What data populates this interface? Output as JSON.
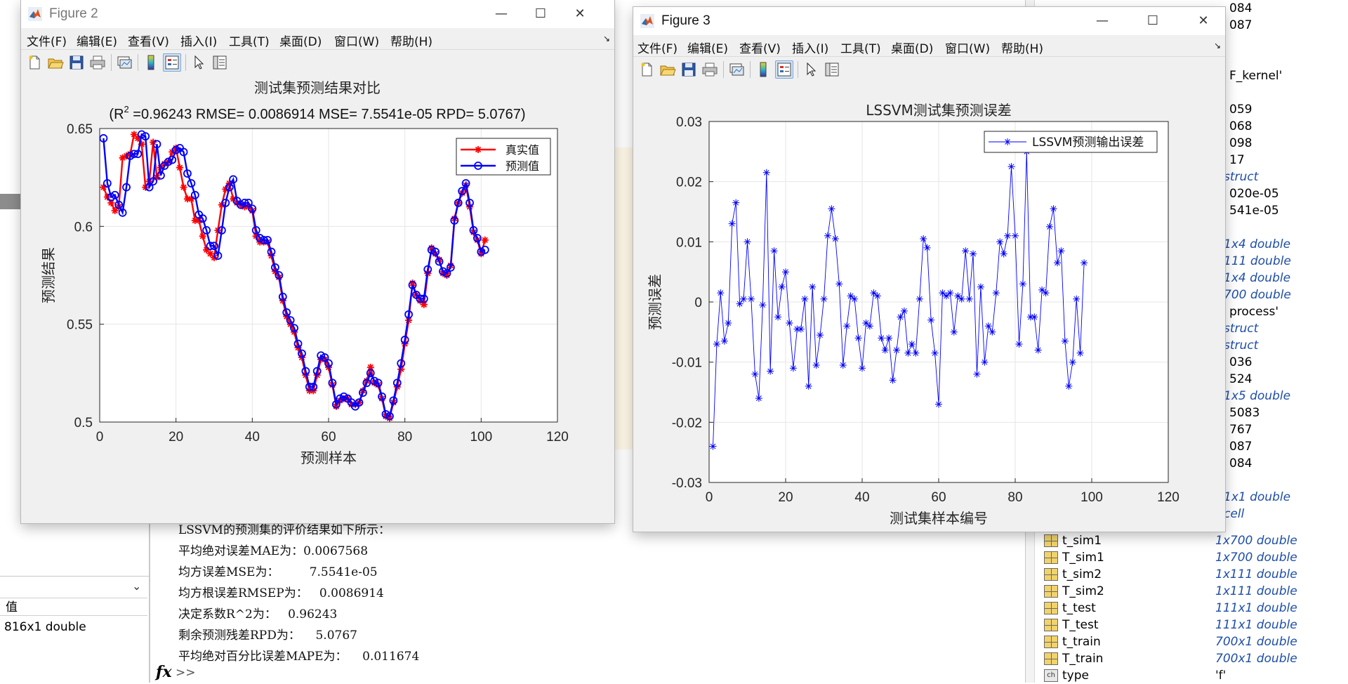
{
  "desktop": {
    "left_panel": {
      "header": "值",
      "value": "816x1 double"
    },
    "command_window": {
      "lines": [
        "LSSVM的预测集的评价结果如下所示：",
        "平均绝对误差MAE为：0.0067568",
        "均方误差MSE为：        7.5541e-05",
        "均方根误差RMSEP为：   0.0086914",
        "决定系数R^2为：   0.96243",
        "剩余预测残差RPD为：    5.0767",
        "平均绝对百分比误差MAPE为：    0.011674"
      ],
      "fx": "fx",
      "prompt": ">>"
    },
    "workspace": {
      "fragments_top": [
        "084",
        "087",
        "F_kernel'",
        "059",
        "068",
        "098",
        "17",
        "struct",
        "020e-05",
        "541e-05",
        "1x4 double",
        "111 double",
        "1x4 double",
        "700 double",
        "process'",
        "struct",
        "struct",
        "036",
        "524",
        "1x5 double",
        "5083",
        "767",
        "087",
        "084",
        "1x1 double",
        "cell"
      ],
      "rows": [
        {
          "name": "t_sim1",
          "value": "1x700 double"
        },
        {
          "name": "T_sim1",
          "value": "1x700 double"
        },
        {
          "name": "t_sim2",
          "value": "1x111 double"
        },
        {
          "name": "T_sim2",
          "value": "1x111 double"
        },
        {
          "name": "t_test",
          "value": "111x1 double"
        },
        {
          "name": "T_test",
          "value": "111x1 double"
        },
        {
          "name": "t_train",
          "value": "700x1 double"
        },
        {
          "name": "T_train",
          "value": "700x1 double"
        },
        {
          "name": "type",
          "value": "'f'"
        }
      ]
    }
  },
  "menu": [
    "文件(F)",
    "编辑(E)",
    "查看(V)",
    "插入(I)",
    "工具(T)",
    "桌面(D)",
    "窗口(W)",
    "帮助(H)"
  ],
  "window_buttons": {
    "minimize": "—",
    "maximize": "☐",
    "close": "✕"
  },
  "figure2": {
    "title": "Figure 2",
    "chart_data": {
      "type": "line",
      "title": "测试集预测结果对比",
      "subtitle_prefix": "(R",
      "subtitle_sup": "2",
      "subtitle_rest": " =0.96243 RMSE= 0.0086914 MSE= 7.5541e-05 RPD= 5.0767)",
      "xlabel": "预测样本",
      "ylabel": "预测结果",
      "xlim": [
        0,
        120
      ],
      "ylim": [
        0.5,
        0.65
      ],
      "xticks": [
        "0",
        "20",
        "40",
        "60",
        "80",
        "100",
        "120"
      ],
      "yticks": [
        "0.5",
        "0.55",
        "0.6",
        "0.65"
      ],
      "grid": true,
      "legend": "top-right",
      "series": [
        {
          "name": "真实值",
          "color": "#ff0000",
          "marker": "star",
          "values": [
            0.62,
            0.615,
            0.612,
            0.608,
            0.61,
            0.635,
            0.636,
            0.637,
            0.647,
            0.645,
            0.642,
            0.62,
            0.623,
            0.643,
            0.625,
            0.63,
            0.632,
            0.633,
            0.638,
            0.64,
            0.63,
            0.62,
            0.614,
            0.614,
            0.603,
            0.603,
            0.595,
            0.588,
            0.586,
            0.584,
            0.598,
            0.611,
            0.619,
            0.622,
            0.614,
            0.612,
            0.611,
            0.61,
            0.61,
            0.608,
            0.595,
            0.592,
            0.592,
            0.592,
            0.585,
            0.577,
            0.574,
            0.562,
            0.554,
            0.55,
            0.546,
            0.538,
            0.533,
            0.524,
            0.516,
            0.516,
            0.524,
            0.532,
            0.532,
            0.528,
            0.519,
            0.508,
            0.511,
            0.512,
            0.512,
            0.509,
            0.509,
            0.51,
            0.516,
            0.521,
            0.528,
            0.52,
            0.519,
            0.512,
            0.503,
            0.502,
            0.51,
            0.518,
            0.527,
            0.54,
            0.552,
            0.571,
            0.565,
            0.562,
            0.56,
            0.576,
            0.589,
            0.586,
            0.583,
            0.576,
            0.575,
            0.58,
            0.604,
            0.612,
            0.617,
            0.621,
            0.61,
            0.597,
            0.593,
            0.586,
            0.593
          ]
        },
        {
          "name": "预测值",
          "color": "#0000ff",
          "marker": "circle",
          "values": [
            0.645,
            0.622,
            0.615,
            0.616,
            0.611,
            0.607,
            0.62,
            0.636,
            0.637,
            0.637,
            0.647,
            0.646,
            0.62,
            0.623,
            0.642,
            0.626,
            0.631,
            0.633,
            0.634,
            0.639,
            0.64,
            0.638,
            0.627,
            0.622,
            0.616,
            0.606,
            0.604,
            0.598,
            0.59,
            0.59,
            0.585,
            0.598,
            0.612,
            0.62,
            0.624,
            0.613,
            0.611,
            0.612,
            0.612,
            0.609,
            0.598,
            0.594,
            0.593,
            0.593,
            0.587,
            0.579,
            0.575,
            0.564,
            0.556,
            0.552,
            0.548,
            0.54,
            0.535,
            0.526,
            0.518,
            0.518,
            0.526,
            0.534,
            0.533,
            0.53,
            0.52,
            0.509,
            0.512,
            0.513,
            0.512,
            0.51,
            0.508,
            0.51,
            0.515,
            0.52,
            0.525,
            0.521,
            0.52,
            0.513,
            0.504,
            0.503,
            0.511,
            0.52,
            0.53,
            0.542,
            0.555,
            0.57,
            0.565,
            0.563,
            0.563,
            0.578,
            0.588,
            0.587,
            0.582,
            0.577,
            0.576,
            0.579,
            0.603,
            0.612,
            0.618,
            0.622,
            0.612,
            0.598,
            0.594,
            0.587,
            0.588
          ]
        }
      ]
    }
  },
  "figure3": {
    "title": "Figure 3",
    "chart_data": {
      "type": "line",
      "title": "LSSVM测试集预测误差",
      "xlabel": "测试集样本编号",
      "ylabel": "预测误差",
      "xlim": [
        0,
        120
      ],
      "ylim": [
        -0.03,
        0.03
      ],
      "xticks": [
        "0",
        "20",
        "40",
        "60",
        "80",
        "100",
        "120"
      ],
      "yticks": [
        "-0.03",
        "-0.02",
        "-0.01",
        "0",
        "0.01",
        "0.02",
        "0.03"
      ],
      "grid": true,
      "legend": "top-right",
      "series": [
        {
          "name": "LSSVM预测输出误差",
          "color": "#0000ff",
          "marker": "star",
          "values": [
            -0.024,
            -0.007,
            0.0015,
            -0.0065,
            -0.0035,
            0.013,
            0.0165,
            -0.0003,
            0.0005,
            0.01,
            0.0005,
            -0.012,
            -0.016,
            -0.0005,
            0.0215,
            -0.0115,
            0.0085,
            -0.0025,
            0.0025,
            0.005,
            -0.0035,
            -0.011,
            -0.0045,
            -0.0045,
            0.0005,
            -0.014,
            0.0025,
            -0.0105,
            -0.0055,
            0.0005,
            0.011,
            0.0155,
            0.0105,
            0.003,
            -0.0105,
            -0.004,
            0.001,
            0.0005,
            -0.006,
            -0.011,
            -0.0035,
            -0.004,
            0.0015,
            0.001,
            -0.006,
            -0.008,
            -0.006,
            -0.013,
            -0.008,
            -0.0025,
            -0.0015,
            -0.0085,
            -0.007,
            -0.0085,
            0.0005,
            0.0105,
            0.009,
            -0.003,
            -0.0085,
            -0.017,
            0.0015,
            0.001,
            0.0015,
            -0.005,
            0.001,
            0.0005,
            0.0085,
            0.0005,
            0.008,
            -0.012,
            0.0025,
            -0.01,
            -0.004,
            -0.005,
            0.0015,
            0.01,
            0.008,
            0.011,
            0.0225,
            0.011,
            -0.007,
            0.003,
            0.025,
            -0.0025,
            -0.0025,
            -0.008,
            0.002,
            0.0015,
            0.0125,
            0.0155,
            0.0065,
            0.0085,
            -0.0065,
            -0.014,
            -0.01,
            0.0005,
            -0.0085,
            0.0065
          ]
        }
      ]
    }
  }
}
